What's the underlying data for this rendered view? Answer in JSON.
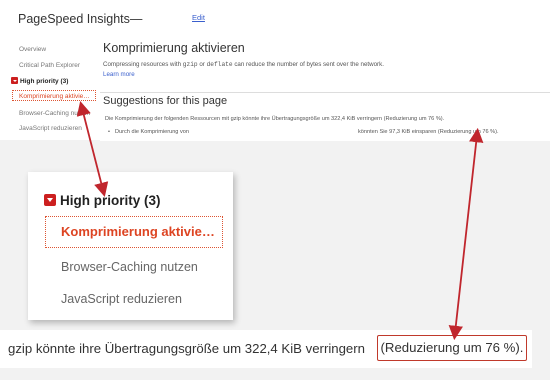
{
  "app": {
    "title": "PageSpeed Insights—",
    "edit_link": "Edit"
  },
  "sidebar": {
    "items": [
      "Overview",
      "Critical Path Explorer"
    ],
    "group_label": "High priority (3)",
    "active_item": "Komprimierung aktivie…",
    "other_items": [
      "Browser-Caching nutzen",
      "JavaScript reduzieren"
    ]
  },
  "main": {
    "title": "Komprimierung aktivieren",
    "description_pre": "Compressing resources with ",
    "code1": "gzip",
    "description_mid": " or ",
    "code2": "deflate",
    "description_post": " can reduce the number of bytes sent over the network.",
    "learn_more": "Learn more",
    "suggestions_title": "Suggestions for this page",
    "suggestion_text": "Die Komprimierung der folgenden Ressourcen mit gzip könnte ihre Übertragungsgröße um 322,4 KiB verringern (Reduzierung um 76 %).",
    "bullet_start": "Durch die Komprimierung von",
    "bullet_end": "könnten Sie 97,3 KiB einsparen (Reduzierung um 76 %)."
  },
  "zoom_sidebar": {
    "group_label": "High priority (3)",
    "active_item": "Komprimierung aktivie…",
    "items": [
      "Browser-Caching nutzen",
      "JavaScript reduzieren"
    ]
  },
  "zoom_text": {
    "text": "gzip könnte ihre Übertragungsgröße um 322,4 KiB verringern",
    "highlight": "(Reduzierung um 76 %)."
  },
  "colors": {
    "accent": "#cc1f1f",
    "link": "#3a5fcd",
    "active_text": "#dd4422"
  }
}
